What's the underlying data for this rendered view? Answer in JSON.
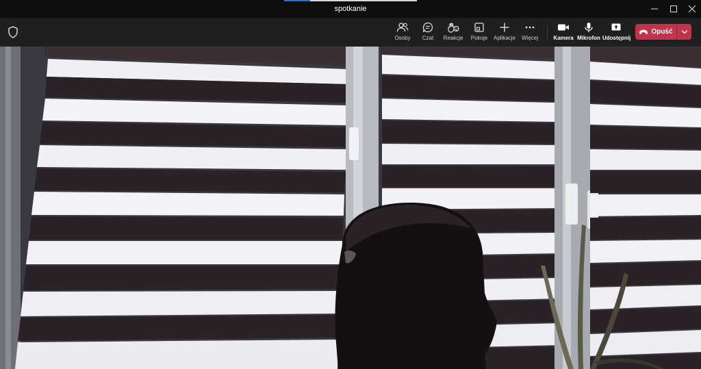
{
  "window": {
    "title": "spotkanie",
    "controls": [
      "minimize-icon",
      "maximize-icon",
      "close-icon"
    ]
  },
  "toolbar": {
    "security_icon": "shield-icon",
    "items": [
      {
        "label": "Osoby",
        "icon": "people-icon"
      },
      {
        "label": "Czat",
        "icon": "chat-icon"
      },
      {
        "label": "Reakcje",
        "icon": "reactions-icon"
      },
      {
        "label": "Pokoje",
        "icon": "breakout-rooms-icon"
      },
      {
        "label": "Aplikacje",
        "icon": "add-apps-icon"
      },
      {
        "label": "Więcej",
        "icon": "more-icon"
      },
      {
        "label": "Kamera",
        "icon": "camera-icon"
      },
      {
        "label": "Mikrofon",
        "icon": "microphone-icon"
      },
      {
        "label": "Udostępnij",
        "icon": "share-icon"
      }
    ],
    "leave": {
      "label": "Opuść",
      "icon": "phone-hangup-icon"
    }
  },
  "colors": {
    "toolbar_bg": "#1f1f1f",
    "titlebar_bg": "#0e0e0e",
    "leave_red": "#c4314b",
    "accent_blue": "#2f6fd0"
  }
}
